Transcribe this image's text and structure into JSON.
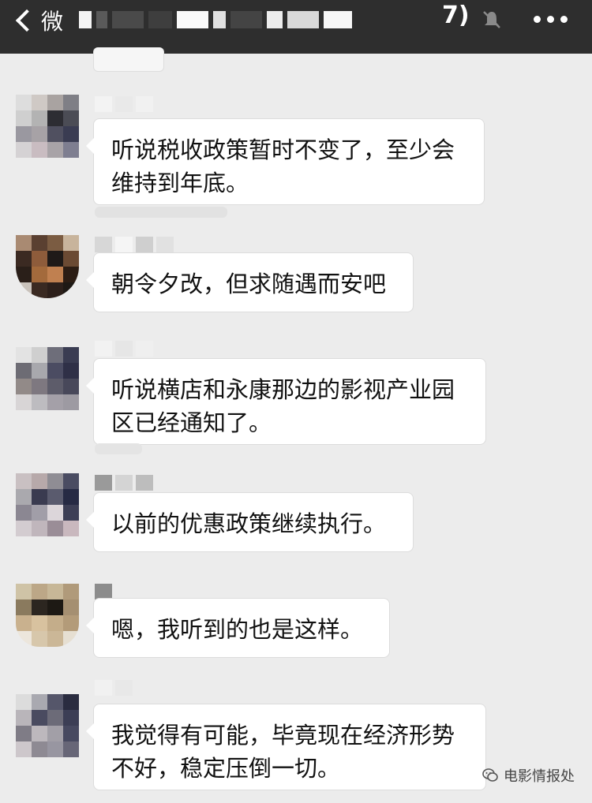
{
  "header": {
    "back_label": "微",
    "title_suffix": "7)",
    "icons": {
      "back": "chevron-left-icon",
      "mute": "muted-bell-icon",
      "more": "more-dots-icon"
    }
  },
  "messages": [
    {
      "text_line1": "听说税收政策暂时不变了，至少会",
      "text_line2": "维持到年底。"
    },
    {
      "text_line1": "朝令夕改，但求随遇而安吧",
      "text_line2": ""
    },
    {
      "text_line1": "听说横店和永康那边的影视产业园",
      "text_line2": "区已经通知了。"
    },
    {
      "text_line1": "以前的优惠政策继续执行。",
      "text_line2": ""
    },
    {
      "text_line1": "嗯，我听到的也是这样。",
      "text_line2": ""
    },
    {
      "text_line1": "我觉得有可能，毕竟现在经济形势",
      "text_line2": "不好，稳定压倒一切。"
    }
  ],
  "watermark": {
    "label": "电影情报处",
    "icon": "wechat-icon"
  },
  "colors": {
    "header_bg": "#2e2e2e",
    "chat_bg": "#ececec",
    "bubble_bg": "#ffffff"
  }
}
